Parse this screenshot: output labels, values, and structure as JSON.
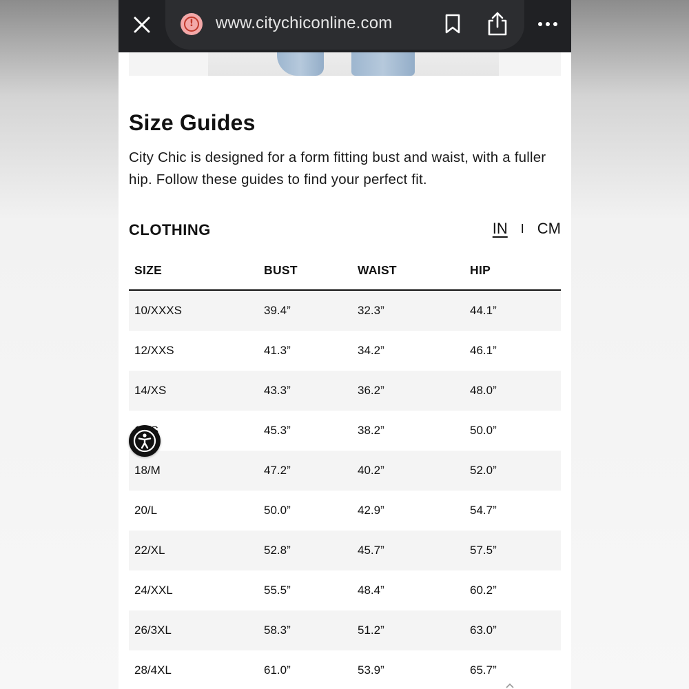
{
  "browser": {
    "url": "www.citychiconline.com",
    "close_icon": "close-icon",
    "warning_icon": "!",
    "bookmark_icon": "bookmark-icon",
    "share_icon": "share-icon",
    "more_icon": "more-icon"
  },
  "page": {
    "title": "Size Guides",
    "intro": "City Chic is designed for a form fitting bust and waist, with a fuller hip. Follow these guides to find your perfect fit.",
    "section": "CLOTHING",
    "units": {
      "in": "IN",
      "separator": "I",
      "cm": "CM",
      "selected": "IN"
    }
  },
  "table": {
    "headers": [
      "SIZE",
      "BUST",
      "WAIST",
      "HIP"
    ],
    "rows": [
      [
        "10/XXXS",
        "39.4”",
        "32.3”",
        "44.1”"
      ],
      [
        "12/XXS",
        "41.3”",
        "34.2”",
        "46.1”"
      ],
      [
        "14/XS",
        "43.3”",
        "36.2”",
        "48.0”"
      ],
      [
        "16/S",
        "45.3”",
        "38.2”",
        "50.0”"
      ],
      [
        "18/M",
        "47.2”",
        "40.2”",
        "52.0”"
      ],
      [
        "20/L",
        "50.0”",
        "42.9”",
        "54.7”"
      ],
      [
        "22/XL",
        "52.8”",
        "45.7”",
        "57.5”"
      ],
      [
        "24/XXL",
        "55.5”",
        "48.4”",
        "60.2”"
      ],
      [
        "26/3XL",
        "58.3”",
        "51.2”",
        "63.0”"
      ],
      [
        "28/4XL",
        "61.0”",
        "53.9”",
        "65.7”"
      ]
    ]
  },
  "colors": {
    "browser_bar": "#202124",
    "url_pill": "#2c2d30",
    "warning": "#f3a8a8",
    "row_stripe": "#f4f4f4",
    "text": "#111111"
  }
}
